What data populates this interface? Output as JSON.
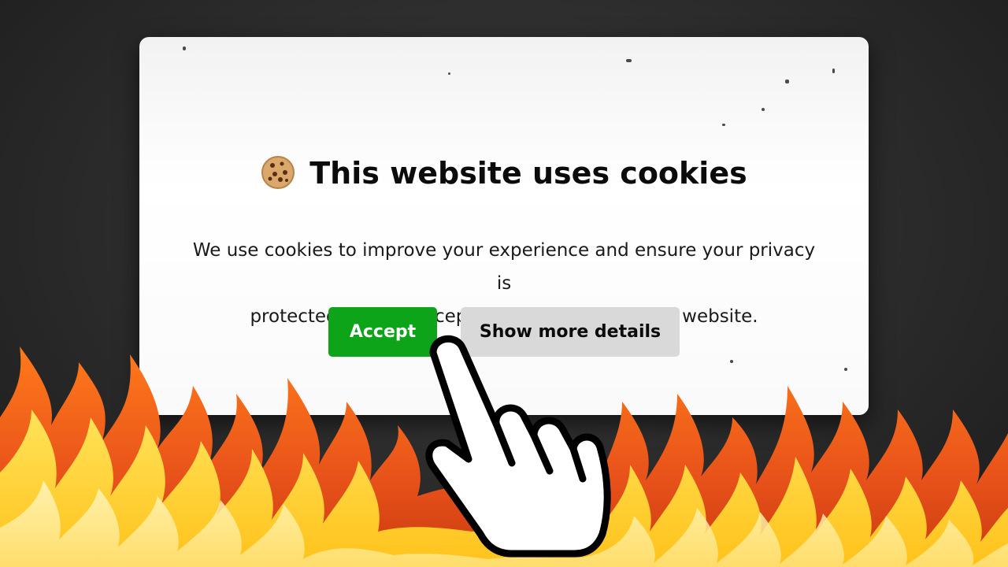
{
  "dialog": {
    "title": "This website uses cookies",
    "body_lines": [
      "We use cookies to improve your experience and ensure your privacy is",
      "protected. Please accept to continue using this website."
    ],
    "accept_label": "Accept",
    "details_label": "Show more details"
  },
  "icons": {
    "title_icon": "cookie-icon",
    "cursor": "hand-pointer-cursor-icon"
  },
  "colors": {
    "accept": "#0ea41a",
    "details": "#d9d9d9",
    "fire_outer": "#e8521a",
    "fire_inner": "#ffd02a"
  }
}
